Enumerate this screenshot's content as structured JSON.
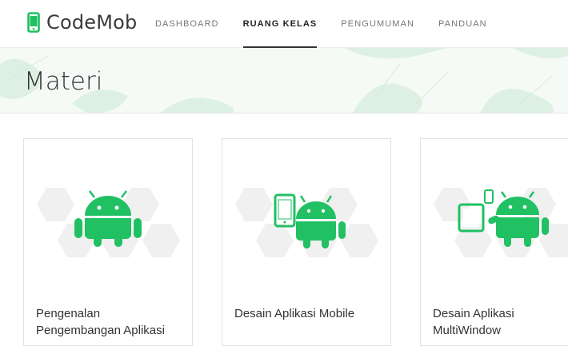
{
  "brand": {
    "name": "CodeMob",
    "accent": "#21c063"
  },
  "nav": {
    "items": [
      {
        "label": "DASHBOARD",
        "active": false
      },
      {
        "label": "RUANG KELAS",
        "active": true
      },
      {
        "label": "PENGUMUMAN",
        "active": false
      },
      {
        "label": "PANDUAN",
        "active": false
      }
    ]
  },
  "page": {
    "title": "Materi"
  },
  "courses": [
    {
      "title": "Pengenalan Pengembangan Aplikasi",
      "icon": "android-icon"
    },
    {
      "title": "Desain Aplikasi Mobile",
      "icon": "phone-android-icon"
    },
    {
      "title": "Desain Aplikasi MultiWindow",
      "icon": "multiwindow-android-icon"
    }
  ]
}
